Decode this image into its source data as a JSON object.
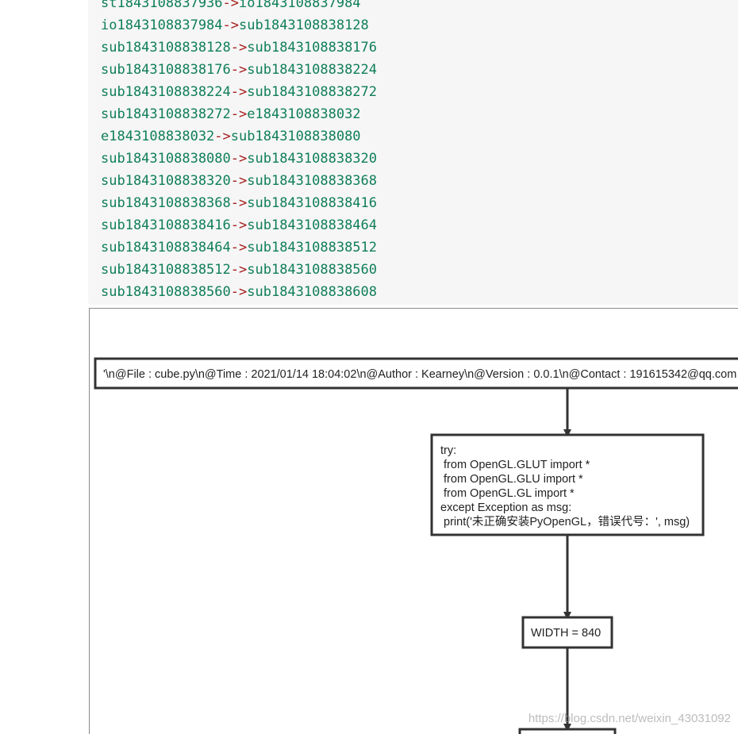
{
  "code": {
    "lines": [
      {
        "from": "st1843108837936",
        "arrow": "->",
        "to": "io1843108837984"
      },
      {
        "from": "io1843108837984",
        "arrow": "->",
        "to": "sub1843108838128"
      },
      {
        "from": "sub1843108838128",
        "arrow": "->",
        "to": "sub1843108838176"
      },
      {
        "from": "sub1843108838176",
        "arrow": "->",
        "to": "sub1843108838224"
      },
      {
        "from": "sub1843108838224",
        "arrow": "->",
        "to": "sub1843108838272"
      },
      {
        "from": "sub1843108838272",
        "arrow": "->",
        "to": "e1843108838032"
      },
      {
        "from": "e1843108838032",
        "arrow": "->",
        "to": "sub1843108838080"
      },
      {
        "from": "sub1843108838080",
        "arrow": "->",
        "to": "sub1843108838320"
      },
      {
        "from": "sub1843108838320",
        "arrow": "->",
        "to": "sub1843108838368"
      },
      {
        "from": "sub1843108838368",
        "arrow": "->",
        "to": "sub1843108838416"
      },
      {
        "from": "sub1843108838416",
        "arrow": "->",
        "to": "sub1843108838464"
      },
      {
        "from": "sub1843108838464",
        "arrow": "->",
        "to": "sub1843108838512"
      },
      {
        "from": "sub1843108838512",
        "arrow": "->",
        "to": "sub1843108838560"
      },
      {
        "from": "sub1843108838560",
        "arrow": "->",
        "to": "sub1843108838608"
      }
    ]
  },
  "flowchart": {
    "nodes": [
      {
        "id": "io-header",
        "lines": [
          "'\\n@File : cube.py\\n@Time : 2021/01/14 18:04:02\\n@Author : Kearney\\n@Version : 0.0.1\\n@Contact : 191615342@qq.com"
        ]
      },
      {
        "id": "try-import",
        "lines": [
          "try:",
          " from OpenGL.GLUT import *",
          " from OpenGL.GLU import *",
          " from OpenGL.GL import *",
          "except Exception as msg:",
          " print('未正确安装PyOpenGL，错误代号：', msg)"
        ]
      },
      {
        "id": "width-assign",
        "lines": [
          "WIDTH = 840"
        ]
      },
      {
        "id": "next-node",
        "lines": []
      }
    ]
  },
  "watermark": {
    "text": "https://blog.csdn.net/weixin_43031092"
  },
  "colors": {
    "node_id": "#0f7e5a",
    "arrow": "#a51a1a",
    "code_bg": "#f6f6f6",
    "stroke": "#333333"
  }
}
